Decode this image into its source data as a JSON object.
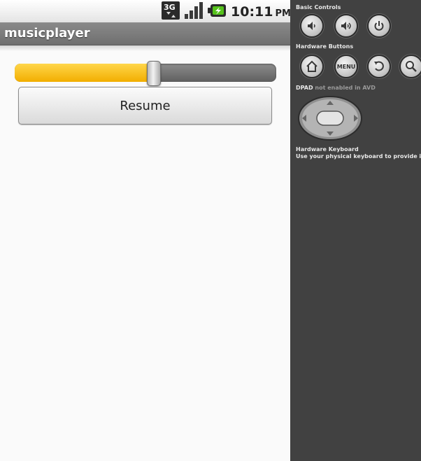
{
  "statusbar": {
    "network_icon": "3g-data-icon",
    "signal_icon": "signal-strength-icon",
    "battery_icon": "battery-charging-icon",
    "time": "10:11",
    "ampm": "PM"
  },
  "app": {
    "title": "musicplayer"
  },
  "player": {
    "seek_progress": 0.53,
    "resume_label": "Resume"
  },
  "controls": {
    "basic_controls_label": "Basic Controls",
    "hardware_buttons_label": "Hardware Buttons",
    "menu_label": "MENU",
    "dpad_label": "DPAD",
    "dpad_note": "not enabled in AVD",
    "keyboard_label": "Hardware Keyboard",
    "keyboard_note": "Use your physical keyboard to provide input"
  },
  "colors": {
    "progress": "#f2ae00",
    "titlebar": "#7a7a7a",
    "panel": "#414141"
  }
}
